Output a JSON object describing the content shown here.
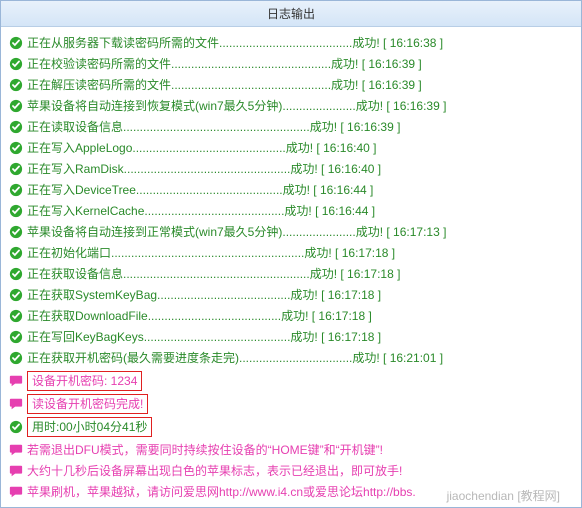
{
  "header": {
    "title": "日志输出"
  },
  "status": {
    "success_label": "成功! ",
    "open_bracket": "[ ",
    "close_bracket": " ]"
  },
  "logs": [
    {
      "type": "success",
      "text": "正在从服务器下载读密码所需的文件",
      "time": "16:16:38"
    },
    {
      "type": "success",
      "text": "正在校验读密码所需的文件",
      "time": "16:16:39"
    },
    {
      "type": "success",
      "text": "正在解压读密码所需的文件",
      "time": "16:16:39"
    },
    {
      "type": "success",
      "text": "苹果设备将自动连接到恢复模式(win7最久5分钟)",
      "time": "16:16:39"
    },
    {
      "type": "success",
      "text": "正在读取设备信息",
      "time": "16:16:39"
    },
    {
      "type": "success",
      "text": "正在写入AppleLogo",
      "time": "16:16:40"
    },
    {
      "type": "success",
      "text": "正在写入RamDisk",
      "time": "16:16:40"
    },
    {
      "type": "success",
      "text": "正在写入DeviceTree",
      "time": "16:16:44"
    },
    {
      "type": "success",
      "text": "正在写入KernelCache",
      "time": "16:16:44"
    },
    {
      "type": "success",
      "text": "苹果设备将自动连接到正常模式(win7最久5分钟)",
      "time": "16:17:13"
    },
    {
      "type": "success",
      "text": "正在初始化端口",
      "time": "16:17:18"
    },
    {
      "type": "success",
      "text": "正在获取设备信息",
      "time": "16:17:18"
    },
    {
      "type": "success",
      "text": "正在获取SystemKeyBag",
      "time": "16:17:18"
    },
    {
      "type": "success",
      "text": "正在获取DownloadFile",
      "time": "16:17:18"
    },
    {
      "type": "success",
      "text": "正在写回KeyBagKeys",
      "time": "16:17:18"
    },
    {
      "type": "success",
      "text": "正在获取开机密码(最久需要进度条走完)",
      "time": "16:21:01"
    }
  ],
  "results": {
    "password_label": "设备开机密码: ",
    "password_value": "1234",
    "done_text": "读设备开机密码完成!",
    "elapsed_text": "用时:00小时04分41秒"
  },
  "messages": [
    "若需退出DFU模式，需要同时持续按住设备的“HOME键”和“开机键”!",
    "大约十几秒后设备屏幕出现白色的苹果标志，表示已经退出，即可放手!",
    "苹果刷机，苹果越狱，请访问爱思网http://www.i4.cn或爱思论坛http://bbs."
  ],
  "watermark": "jiaochendian [教程网]"
}
